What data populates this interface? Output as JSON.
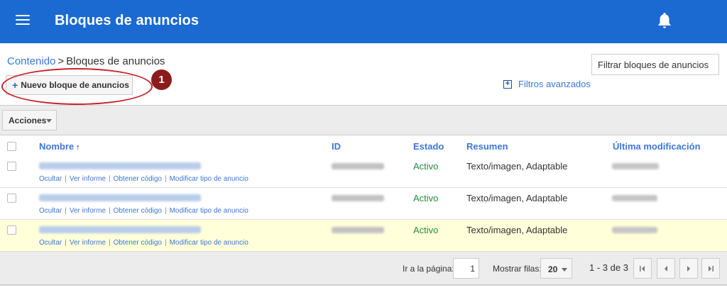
{
  "app": {
    "title": "Bloques de anuncios"
  },
  "breadcrumb": {
    "parent": "Contenido",
    "separator": ">",
    "current": "Bloques de anuncios"
  },
  "filter": {
    "placeholder": "Filtrar bloques de anuncios"
  },
  "toolbar": {
    "new_button": "Nuevo bloque de anuncios",
    "step_number": "1",
    "advanced_filters": "Filtros avanzados",
    "actions": "Acciones"
  },
  "table": {
    "columns": {
      "nombre": "Nombre",
      "id": "ID",
      "estado": "Estado",
      "resumen": "Resumen",
      "modificacion": "Última modificación"
    },
    "rows": [
      {
        "estado": "Activo",
        "resumen": "Texto/imagen, Adaptable",
        "highlighted": false
      },
      {
        "estado": "Activo",
        "resumen": "Texto/imagen, Adaptable",
        "highlighted": false
      },
      {
        "estado": "Activo",
        "resumen": "Texto/imagen, Adaptable",
        "highlighted": true
      }
    ],
    "row_actions": {
      "hide": "Ocultar",
      "report": "Ver informe",
      "code": "Obtener código",
      "modify": "Modificar tipo de anuncio"
    }
  },
  "pagination": {
    "goto_label": "Ir a la página:",
    "page_value": "1",
    "rows_label": "Mostrar filas:",
    "rows_value": "20",
    "range": "1 - 3 de 3"
  },
  "colors": {
    "header_bg": "#1a6ad2",
    "link": "#3b78d8",
    "status_active": "#1e8e3e",
    "highlight_row": "#ffffd9",
    "annotation": "#c8232c"
  },
  "icons": [
    "menu-icon",
    "bell-icon",
    "plus-icon",
    "expand-plus-icon",
    "sort-up-icon",
    "chevron-down-icon",
    "first-page-icon",
    "prev-page-icon",
    "next-page-icon",
    "last-page-icon"
  ]
}
